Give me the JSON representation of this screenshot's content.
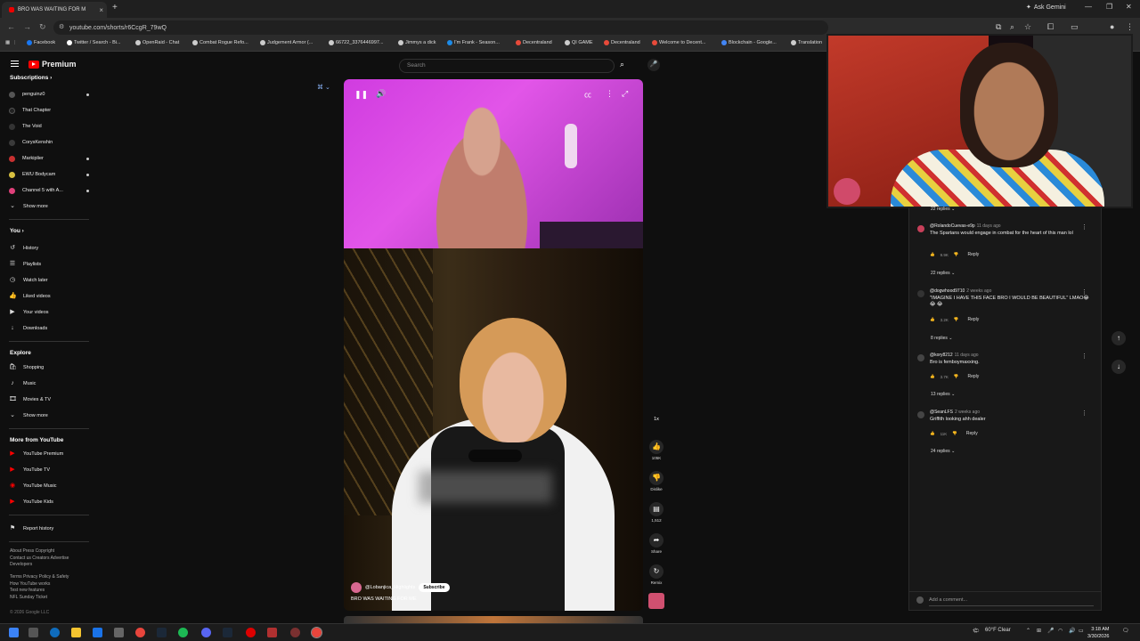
{
  "browser": {
    "tab_title": "BRO WAS WAITING FOR M",
    "new_tab": "+",
    "url": "youtube.com/shorts/r6CcgR_79wQ",
    "ask_label": "Ask Gemini",
    "bookmarks": [
      {
        "label": "Facebook",
        "color": "#1877f2"
      },
      {
        "label": "Twitter / Search - Bi...",
        "color": "#ffffff"
      },
      {
        "label": "OpenRaid - Chat",
        "color": "#cccccc"
      },
      {
        "label": "Combat Rogue Refo...",
        "color": "#cccccc"
      },
      {
        "label": "Judgement Armor (...",
        "color": "#cccccc"
      },
      {
        "label": "66722_3376446997...",
        "color": "#cccccc"
      },
      {
        "label": "Jimmys a dick",
        "color": "#cccccc"
      },
      {
        "label": "I'm Frank - Season...",
        "color": "#1c8be8"
      },
      {
        "label": "Decentraland",
        "color": "#e84a3a"
      },
      {
        "label": "QI GAME",
        "color": "#cccccc"
      },
      {
        "label": "Decentraland",
        "color": "#e84a3a"
      },
      {
        "label": "Welcome to Decent...",
        "color": "#e84a3a"
      },
      {
        "label": "Blockchain - Google...",
        "color": "#4285f4"
      },
      {
        "label": "Translation",
        "color": "#cccccc"
      }
    ]
  },
  "youtube": {
    "logo": "Premium",
    "search_placeholder": "Search",
    "subscriptions_head": "Subscriptions",
    "subscriptions": [
      {
        "label": "penguinz0",
        "color": "#555555",
        "live": true
      },
      {
        "label": "That Chapter",
        "color": "#222222",
        "live": false
      },
      {
        "label": "The Void",
        "color": "#333333",
        "live": false
      },
      {
        "label": "CorysKenshin",
        "color": "#3a3a3a",
        "live": false
      },
      {
        "label": "Markiplier",
        "color": "#c83030",
        "live": true
      },
      {
        "label": "EWU Bodycam",
        "color": "#d8c040",
        "live": true
      },
      {
        "label": "Channel 5 with A...",
        "color": "#e0407a",
        "live": true
      }
    ],
    "show_more": "Show more",
    "you_head": "You",
    "you_items": [
      {
        "label": "History",
        "icon": "history-icon",
        "glyph": "↺"
      },
      {
        "label": "Playlists",
        "icon": "playlists-icon",
        "glyph": "☰"
      },
      {
        "label": "Watch later",
        "icon": "clock-icon",
        "glyph": "◷"
      },
      {
        "label": "Liked videos",
        "icon": "thumbs-up-icon",
        "glyph": "👍"
      },
      {
        "label": "Your videos",
        "icon": "video-icon",
        "glyph": "▶"
      },
      {
        "label": "Downloads",
        "icon": "download-icon",
        "glyph": "↓"
      }
    ],
    "explore_head": "Explore",
    "explore_items": [
      {
        "label": "Shopping",
        "icon": "shopping-icon",
        "glyph": "🛍"
      },
      {
        "label": "Music",
        "icon": "music-icon",
        "glyph": "♪"
      },
      {
        "label": "Movies & TV",
        "icon": "movies-icon",
        "glyph": "🎞"
      },
      {
        "label": "Show more",
        "icon": "chevron-down-icon",
        "glyph": "⌄"
      }
    ],
    "more_head": "More from YouTube",
    "more_items": [
      {
        "label": "YouTube Premium",
        "color": "#ff0000"
      },
      {
        "label": "YouTube TV",
        "color": "#ff0000"
      },
      {
        "label": "YouTube Music",
        "color": "#ff0000"
      },
      {
        "label": "YouTube Kids",
        "color": "#ff0000"
      }
    ],
    "report_history": "Report history",
    "footer1": "About  Press  Copyright\nContact us  Creators  Advertise\nDevelopers",
    "footer2": "Terms  Privacy  Policy & Safety\nHow YouTube works\nTest new features\nNFL Sunday Ticket",
    "footer3": "© 2026 Google LLC"
  },
  "short": {
    "channel": "@Lobanjica_Highlights",
    "subscribe": "Subscribe",
    "title": "BRO WAS WAITING FOR ME",
    "speed": "1x",
    "likes": "105K",
    "dislike": "Dislike",
    "comments": "1,512",
    "share": "Share",
    "remix": "Remix"
  },
  "comments": {
    "top_replies": "22 replies",
    "items": [
      {
        "author": "@RolandoCuevas-e9p",
        "ago": "11 days ago",
        "text": "The Spartans would engage in combat for the heart of this man lol",
        "likes": "9.9K",
        "replies": "22 replies",
        "color": "#c8405a"
      },
      {
        "author": "@dogwhood9710",
        "ago": "2 weeks ago",
        "text": "\"IMAGINE I HAVE THIS FACE BRO I WOULD BE BEAUTIFUL\" LMAO😂 😂 😂",
        "likes": "3.2K",
        "replies": "8 replies",
        "color": "#333333"
      },
      {
        "author": "@kory8212",
        "ago": "11 days ago",
        "text": "Bro is femboymaxxing.",
        "likes": "3.7K",
        "replies": "13 replies",
        "color": "#444444"
      },
      {
        "author": "@SeanLFS",
        "ago": "2 weeks ago",
        "text": "Griffith looking ahh dealer",
        "likes": "11K",
        "replies": "24 replies",
        "color": "#444444"
      }
    ],
    "reply_label": "Reply",
    "add_placeholder": "Add a comment..."
  },
  "taskbar": {
    "weather": "60°F  Clear",
    "time": "3:18 AM",
    "date": "3/30/2026"
  }
}
